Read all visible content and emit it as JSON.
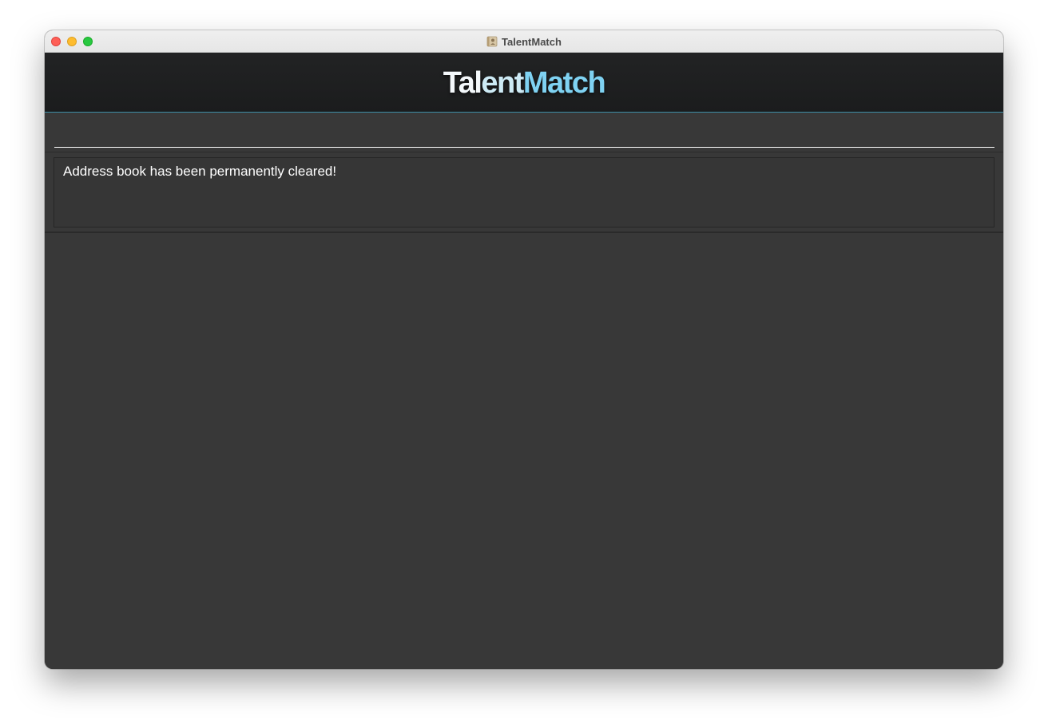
{
  "window": {
    "title": "TalentMatch",
    "app_icon": "address-book-icon"
  },
  "header": {
    "brand_part1": "Tal",
    "brand_part2": "ent",
    "brand_part3": "Match",
    "colors": {
      "background": "#1e1f20",
      "accent_border": "#3e8fa8",
      "brand_light": "#f4f8fb",
      "brand_blue": "#7fd2f2"
    }
  },
  "command": {
    "value": "",
    "placeholder": ""
  },
  "result": {
    "message": "Address book has been permanently cleared!"
  },
  "theme": {
    "panel_background": "#383838",
    "text_color": "#ffffff"
  }
}
